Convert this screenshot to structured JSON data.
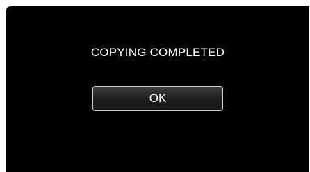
{
  "dialog": {
    "message": "COPYING COMPLETED",
    "ok_label": "OK"
  },
  "colors": {
    "background": "#000000",
    "text": "#ffffff",
    "button_border": "#cfcfcf"
  }
}
